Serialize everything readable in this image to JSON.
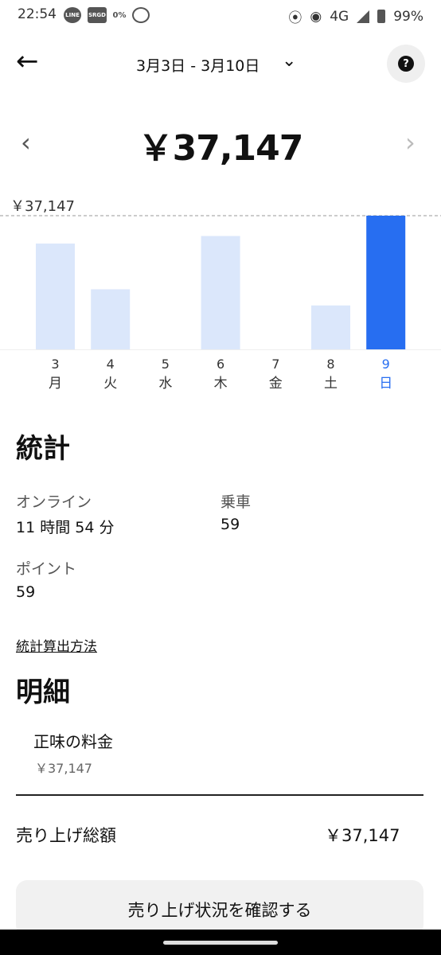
{
  "status_bar": {
    "time": "22:54",
    "app_icons": [
      "LINE",
      "SRGD",
      "0%"
    ],
    "network": "4G",
    "battery": "99%"
  },
  "header": {
    "date_range": "3月3日 - 3月10日",
    "help_icon": "question-mark"
  },
  "summary": {
    "total": "￥37,147"
  },
  "chart_data": {
    "type": "bar",
    "reference_line_label": "￥37,147",
    "reference_value": 37147,
    "categories": [
      "3",
      "4",
      "5",
      "6",
      "7",
      "8",
      "9"
    ],
    "weekdays": [
      "月",
      "火",
      "水",
      "木",
      "金",
      "土",
      "日"
    ],
    "values": [
      29400,
      16700,
      0,
      31500,
      0,
      12200,
      37147
    ],
    "selected_index": 6,
    "ylim": [
      0,
      37147
    ],
    "grid": false,
    "colors": {
      "bar": "#dbe7fb",
      "selected": "#276ef1",
      "selected_label": "#276ef1"
    }
  },
  "stats": {
    "title": "統計",
    "online_label": "オンライン",
    "online_value": "11 時間 54 分",
    "rides_label": "乗車",
    "rides_value": "59",
    "points_label": "ポイント",
    "points_value": "59",
    "method_link": "統計算出方法"
  },
  "breakdown": {
    "title": "明細",
    "net_fare_label": "正味の料金",
    "net_fare_value": "￥37,147",
    "gross_label": "売り上げ総額",
    "gross_value": "￥37,147"
  },
  "action": {
    "label": "売り上げ状況を確認する"
  }
}
